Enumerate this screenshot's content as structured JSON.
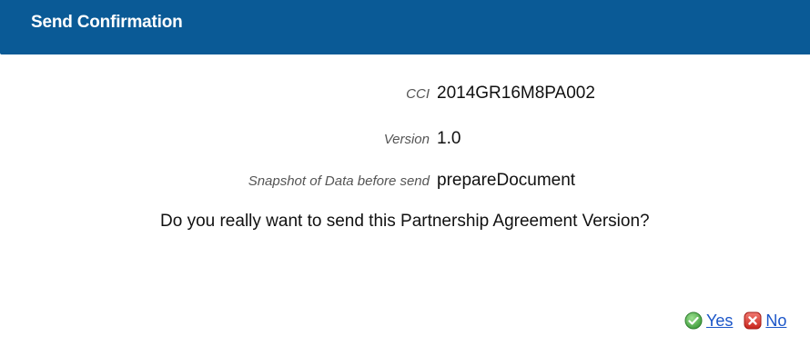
{
  "dialog": {
    "title": "Send Confirmation"
  },
  "fields": {
    "cci": {
      "label": "CCI",
      "value": "2014GR16M8PA002"
    },
    "version": {
      "label": "Version",
      "value": "1.0"
    },
    "snapshot": {
      "label": "Snapshot of Data before send",
      "value": "prepareDocument"
    }
  },
  "question": "Do you really want to send this Partnership Agreement Version?",
  "actions": {
    "yes": {
      "label": "Yes",
      "icon": "check-circle-icon",
      "color": "#4cae4c"
    },
    "no": {
      "label": "No",
      "icon": "close-square-icon",
      "color": "#d9342b"
    }
  },
  "colors": {
    "header_bg": "#0a5a96",
    "link": "#1a55c8"
  }
}
